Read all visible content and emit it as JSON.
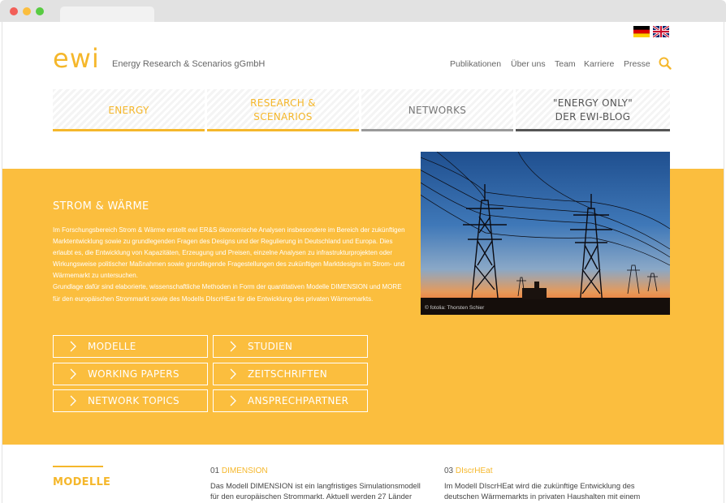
{
  "header": {
    "logo_text": "ewi",
    "company_name": "Energy Research & Scenarios gGmbH",
    "languages": [
      "de",
      "en"
    ],
    "top_nav": [
      "Publikationen",
      "Über uns",
      "Team",
      "Karriere",
      "Presse"
    ],
    "search_icon": "search-icon"
  },
  "main_nav": [
    {
      "line1": "ENERGY",
      "line2": ""
    },
    {
      "line1": "RESEARCH &",
      "line2": "SCENARIOS"
    },
    {
      "line1": "NETWORKS",
      "line2": ""
    },
    {
      "line1": "\"ENERGY ONLY\"",
      "line2": "DER EWI-BLOG"
    }
  ],
  "hero": {
    "title": "STROM & WÄRME",
    "paragraph1": "Im Forschungsbereich Strom & Wärme erstellt ewi ER&S ökonomische Analysen insbesondere im Bereich der zukünftigen Marktentwicklung sowie zu grundlegenden Fragen des Designs und der Regulierung in Deutschland und Europa. Dies erlaubt es, die Entwicklung von Kapazitäten, Erzeugung und Preisen, einzelne Analysen zu infrastrukturprojekten oder Wirkungsweise politischer Maßnahmen sowie grundlegende Fragestellungen des zukünftigen Marktdesigns im Strom- und Wärmemarkt zu untersuchen.",
    "paragraph2": "Grundlage dafür sind elaborierte, wissenschaftliche Methoden in Form der quantitativen Modelle DIMENSION und MORE für den europäischen Strommarkt sowie des Modells DIscrHEat für die Entwicklung des privaten Wärmemarkts.",
    "image_credit": "© fotolia: Thorsten Schier",
    "buttons": [
      "MODELLE",
      "STUDIEN",
      "WORKING PAPERS",
      "ZEITSCHRIFTEN",
      "NETWORK TOPICS",
      "ANSPRECHPARTNER"
    ]
  },
  "models": {
    "title": "MODELLE",
    "items": [
      {
        "num": "01",
        "name": "DIMENSION",
        "text": "Das Modell DIMENSION ist ein langfristiges Simulationsmodell für den europäischen Strommarkt. Aktuell werden 27 Länder"
      },
      {
        "num": "03",
        "name": "DIscrHEat",
        "text": "Im Modell DIscrHEat wird die zukünftige Entwicklung des deutschen Wärmemarkts in privaten Haushalten mit einem"
      }
    ]
  },
  "colors": {
    "accent": "#f5b72b",
    "hero_bg": "#fbbe3e"
  }
}
